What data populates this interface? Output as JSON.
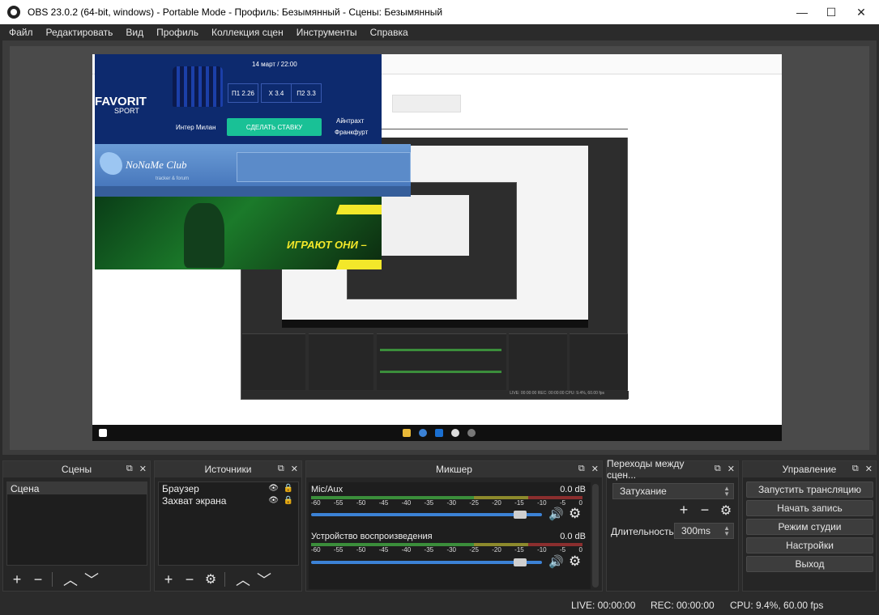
{
  "window": {
    "title": "OBS 23.0.2 (64-bit, windows) - Portable Mode - Профиль: Безымянный - Сцены: Безымянный",
    "minimize": "—",
    "maximize": "☐",
    "close": "✕"
  },
  "menu": [
    "Файл",
    "Редактировать",
    "Вид",
    "Профиль",
    "Коллекция сцен",
    "Инструменты",
    "Справка"
  ],
  "preview": {
    "ad_favorit": {
      "date": "14 март / 22:00",
      "brand": "FAVORIT",
      "brand_sub": "SPORT",
      "odds": [
        "П1 2.26",
        "Х 3.4",
        "П2 3.3"
      ],
      "team_left": "Интер Милан",
      "button": "СДЕЛАТЬ СТАВКУ",
      "team_right_1": "Айнтрахт",
      "team_right_2": "Франкфурт"
    },
    "ad_nnm": {
      "brand": "NoNaMe Club",
      "brand_sub": "tracker & forum"
    },
    "ad_green": {
      "slogan": "ИГРАЮТ ОНИ –"
    },
    "inner_status": "LIVE: 00:00:00   REC: 00:00:00   CPU: 9.4%, 60.00 fps"
  },
  "docks": {
    "scenes": {
      "title": "Сцены",
      "items": [
        "Сцена"
      ]
    },
    "sources": {
      "title": "Источники",
      "items": [
        "Браузер",
        "Захват экрана"
      ]
    },
    "mixer": {
      "title": "Микшер",
      "tracks": [
        {
          "name": "Mic/Aux",
          "db": "0.0 dB",
          "level": 0.93
        },
        {
          "name": "Устройство воспроизведения",
          "db": "0.0 dB",
          "level": 0.93
        }
      ],
      "scale": [
        "-60",
        "-55",
        "-50",
        "-45",
        "-40",
        "-35",
        "-30",
        "-25",
        "-20",
        "-15",
        "-10",
        "-5",
        "0"
      ]
    },
    "transitions": {
      "title": "Переходы между сцен...",
      "selected": "Затухание",
      "duration_label": "Длительность",
      "duration_value": "300ms"
    },
    "controls": {
      "title": "Управление",
      "buttons": [
        "Запустить трансляцию",
        "Начать запись",
        "Режим студии",
        "Настройки",
        "Выход"
      ]
    }
  },
  "status": {
    "live": "LIVE: 00:00:00",
    "rec": "REC: 00:00:00",
    "cpu": "CPU: 9.4%, 60.00 fps"
  },
  "icons": {
    "float": "⧉",
    "close": "✕",
    "add": "+",
    "remove": "−",
    "up": "︿",
    "down": "﹀",
    "gear": "⚙",
    "eye": "👁",
    "lock": "🔒",
    "speaker": "🔊"
  },
  "colors": {
    "background": "#2b2b2b",
    "dock": "#262626",
    "meter_green": "#3b8e3b",
    "meter_yellow": "#8d8a2c",
    "meter_red": "#8b2e2e",
    "slider": "#3c82d6",
    "bet_button": "#19c196",
    "favorit_bg": "#0d2a6e",
    "slogan": "#f3e82a"
  }
}
